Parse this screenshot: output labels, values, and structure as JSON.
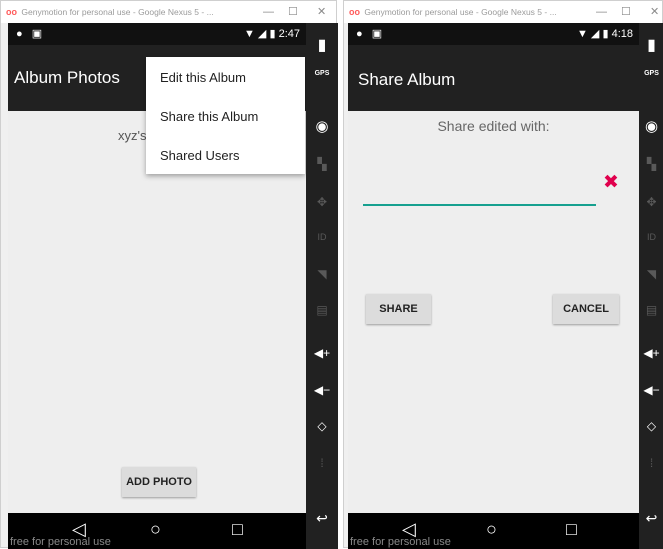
{
  "window_title": "Genymotion for personal use - Google Nexus 5 - ...",
  "window_logo": "oo",
  "window_controls": {
    "minimize": "—",
    "maximize": "☐",
    "close": "✕"
  },
  "left": {
    "status": {
      "time": "2:47",
      "battery_icon": "battery-charging"
    },
    "appbar_title": "Album Photos",
    "body_text": "xyz's",
    "menu_items": [
      "Edit this Album",
      "Share this Album",
      "Shared Users"
    ],
    "add_photo_label": "ADD PHOTO",
    "watermark": "free for personal use"
  },
  "right": {
    "status": {
      "time": "4:18"
    },
    "appbar_title": "Share Album",
    "prompt": "Share edited with:",
    "input_value": "",
    "clear_glyph": "✖",
    "share_label": "SHARE",
    "cancel_label": "CANCEL",
    "watermark": "free for personal use"
  },
  "sidebar": {
    "gps_label": "GPS",
    "id_label": "ID"
  },
  "accent": "#16a08f",
  "clear_color": "#e0004d"
}
